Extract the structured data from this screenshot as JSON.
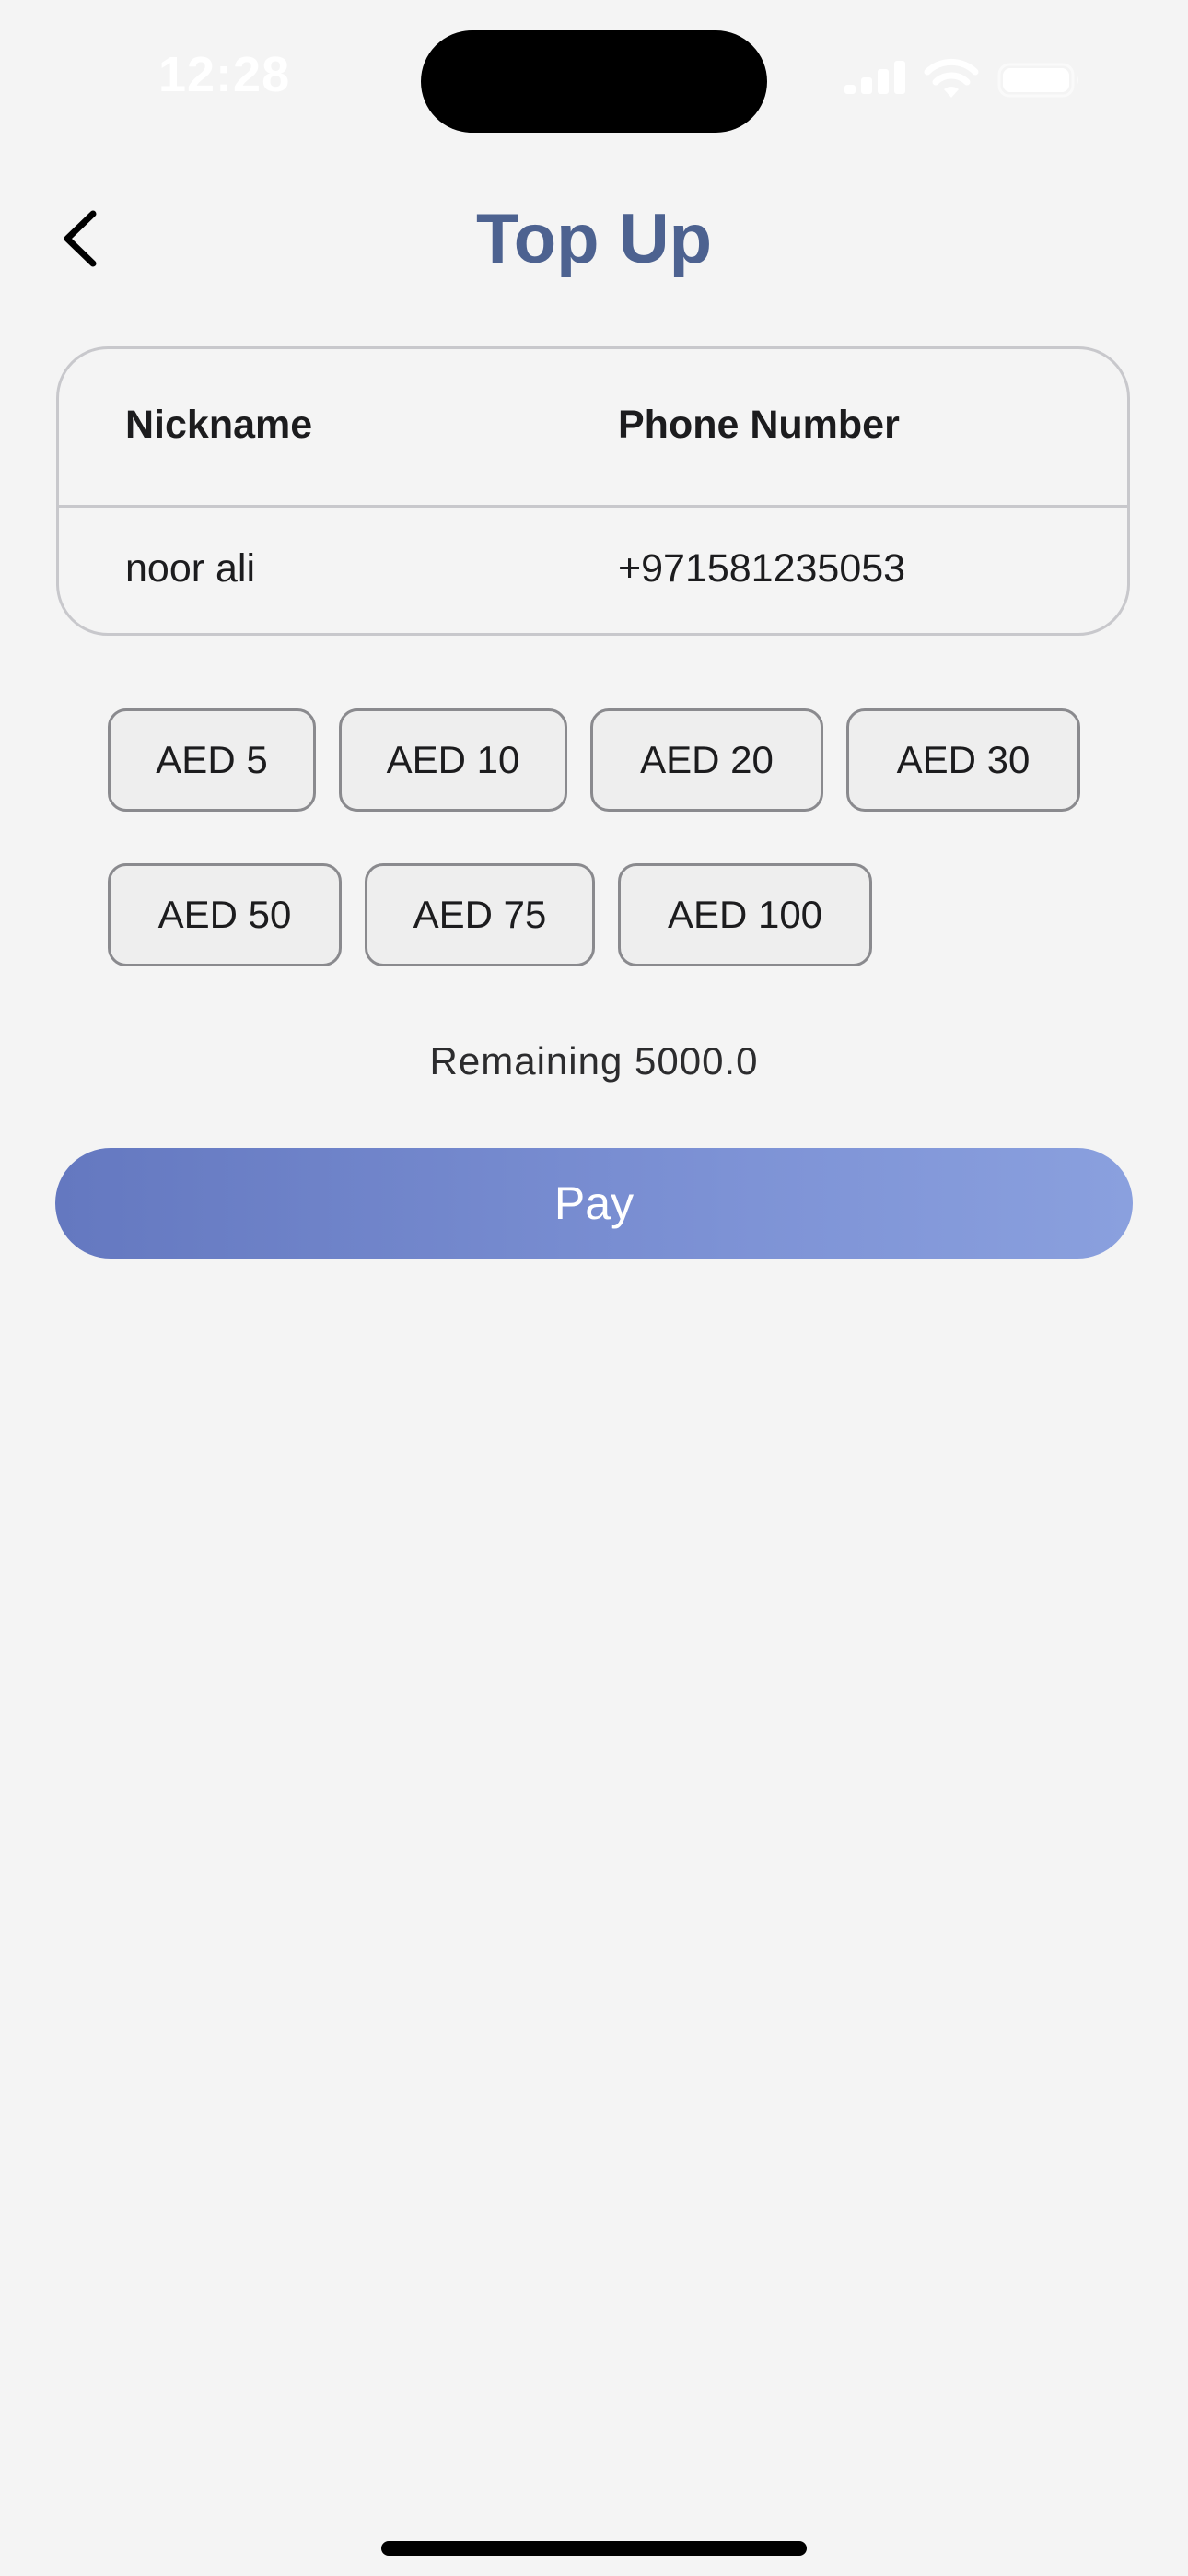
{
  "status_bar": {
    "time": "12:28",
    "signal_icon": "signal-icon",
    "wifi_icon": "wifi-icon",
    "battery_icon": "battery-icon"
  },
  "header": {
    "title": "Top Up",
    "back_icon": "chevron-left-icon"
  },
  "contact_card": {
    "columns": [
      "Nickname",
      "Phone Number"
    ],
    "row": {
      "nickname": "noor ali",
      "phone_number": "+971581235053"
    }
  },
  "amounts": [
    {
      "label": "AED 5"
    },
    {
      "label": "AED 10"
    },
    {
      "label": "AED 20"
    },
    {
      "label": "AED 30"
    },
    {
      "label": "AED 50"
    },
    {
      "label": "AED 75"
    },
    {
      "label": "AED 100"
    }
  ],
  "remaining": "Remaining 5000.0",
  "pay_button": {
    "label": "Pay"
  },
  "colors": {
    "title": "#4d6290",
    "pay_gradient_start": "#6478c0",
    "pay_gradient_end": "#8aa0de",
    "background": "#f4f4f4"
  }
}
